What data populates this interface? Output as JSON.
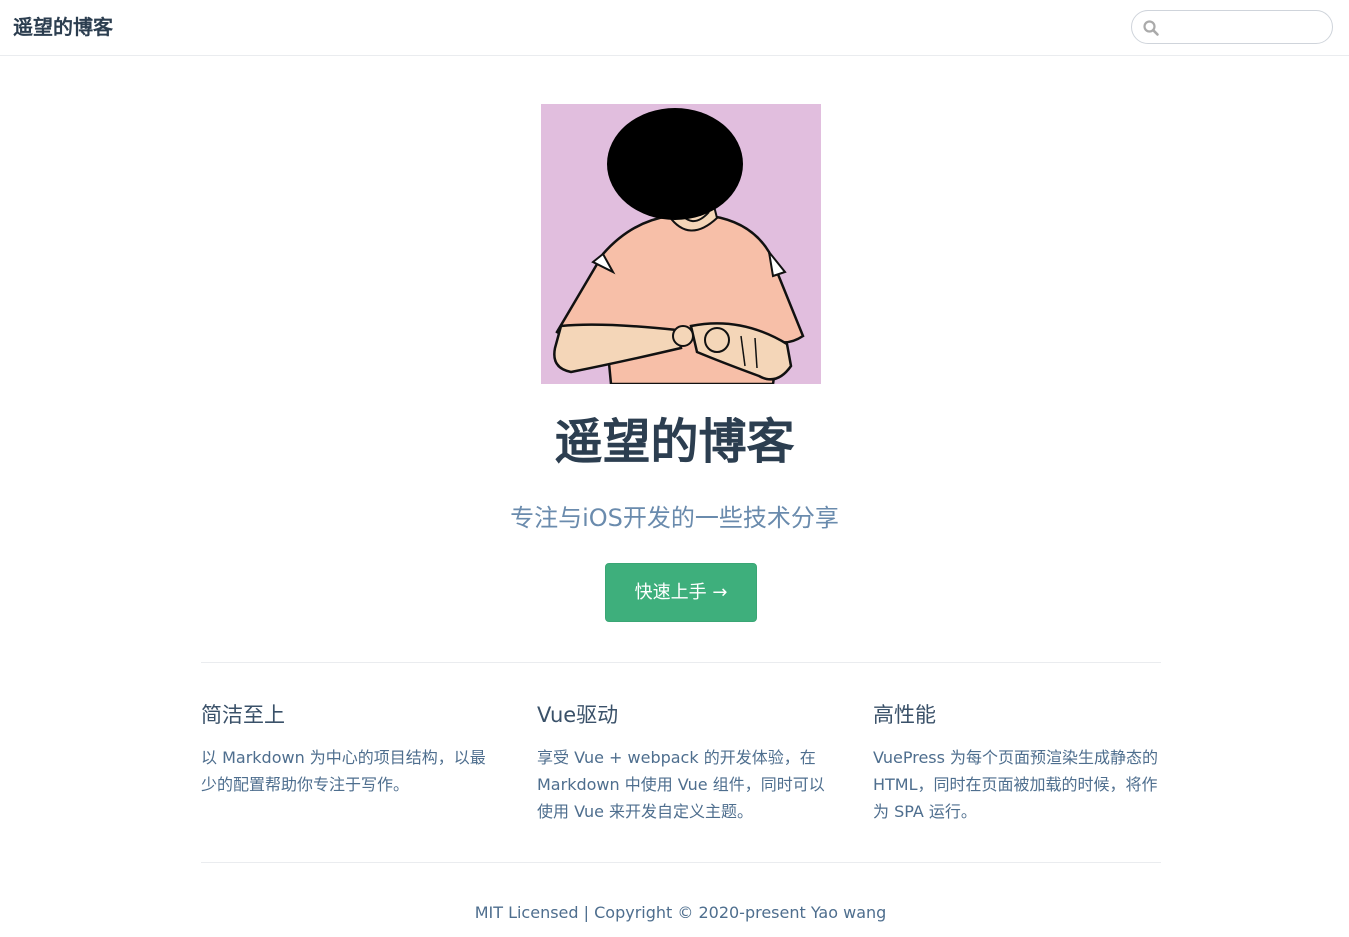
{
  "navbar": {
    "site_name": "遥望的博客",
    "search": {
      "icon": "search-icon",
      "value": "",
      "placeholder": ""
    }
  },
  "hero": {
    "image_desc": "illustrated-avatar",
    "title": "遥望的博客",
    "description": "专注与iOS开发的一些技术分享",
    "action_label": "快速上手 →"
  },
  "features": [
    {
      "title": "简洁至上",
      "details": "以 Markdown 为中心的项目结构，以最少的配置帮助你专注于写作。"
    },
    {
      "title": "Vue驱动",
      "details": "享受 Vue + webpack 的开发体验，在 Markdown 中使用 Vue 组件，同时可以使用 Vue 来开发自定义主题。"
    },
    {
      "title": "高性能",
      "details": "VuePress 为每个页面预渲染生成静态的 HTML，同时在页面被加载的时候，将作为 SPA 运行。"
    }
  ],
  "footer": {
    "text": "MIT Licensed | Copyright © 2020-present Yao wang"
  },
  "colors": {
    "accent": "#3eaf7c",
    "text": "#2c3e50",
    "muted": "#6a8bad",
    "image_bg": "#e1bede"
  }
}
